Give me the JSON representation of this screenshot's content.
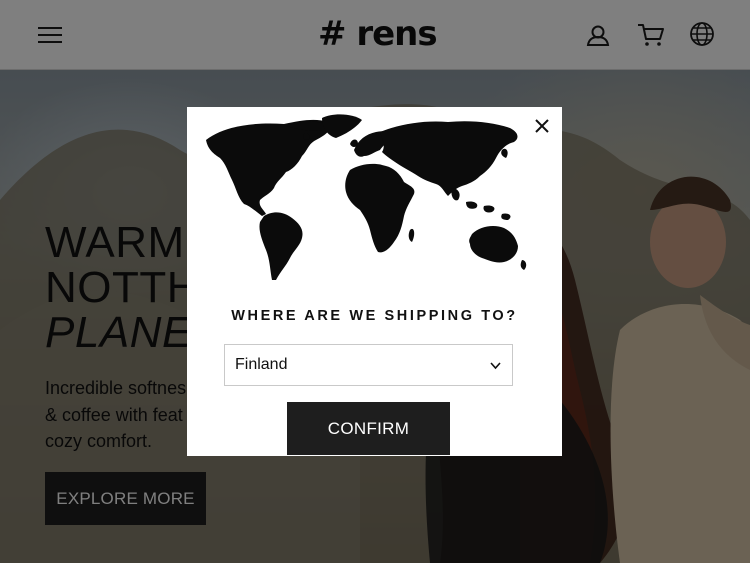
{
  "header": {
    "logo_text": "# rens",
    "icons": [
      "menu-icon",
      "account-icon",
      "cart-icon",
      "globe-icon"
    ]
  },
  "hero": {
    "title_lines": [
      "WARM",
      "NOTTH",
      "PLANE"
    ],
    "subtitle_lines": [
      "Incredible softnes",
      "& coffee with feat",
      "cozy comfort."
    ],
    "cta_label": "EXPLORE MORE"
  },
  "modal": {
    "question": "WHERE ARE WE SHIPPING TO?",
    "country_selected": "Finland",
    "confirm_label": "CONFIRM",
    "close_icon": "close-icon",
    "map_icon": "world-map-icon"
  },
  "colors": {
    "button_bg": "#1e1e1e",
    "header_bg": "#ffffff",
    "overlay": "rgba(0,0,0,0.5)"
  }
}
